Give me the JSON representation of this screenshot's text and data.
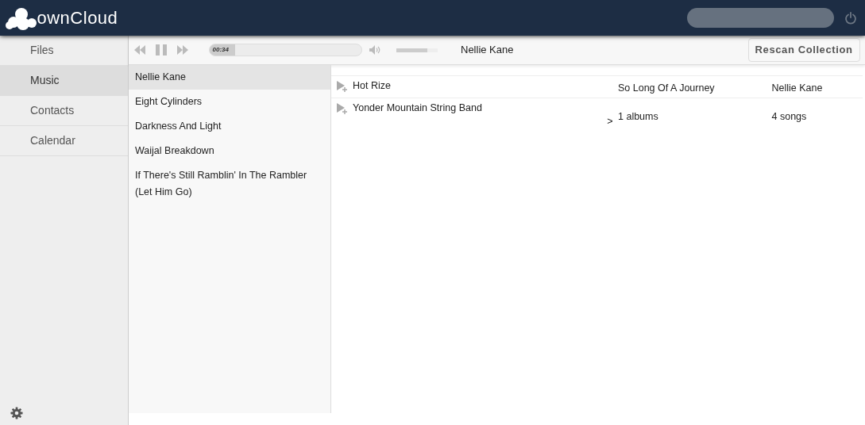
{
  "header": {
    "logo": "ownCloud"
  },
  "navigation": [
    {
      "label": "Files",
      "selected": false
    },
    {
      "label": "Music",
      "selected": true
    },
    {
      "label": "Contacts",
      "selected": false
    },
    {
      "label": "Calendar",
      "selected": false
    }
  ],
  "player": {
    "elapsed": "00:34",
    "level": 0.17,
    "volume": {
      "level": 0.75
    },
    "now_playing": "Nellie Kane",
    "playing": true
  },
  "rescan_button": "Rescan Collection",
  "artists": [
    {
      "name": "Nellie Kane",
      "selected": true
    },
    {
      "name": "Eight Cylinders",
      "selected": false
    },
    {
      "name": "Darkness And Light",
      "selected": false
    },
    {
      "name": "Waijal Breakdown",
      "selected": false
    },
    {
      "name": "If There's Still Ramblin' In The Rambler (Let Him Go)",
      "selected": false
    }
  ],
  "rows": [
    {
      "artist": "Hot Rize",
      "column_2": "So Long Of A Journey",
      "column_3": "Nellie Kane"
    },
    {
      "artist": "Yonder Mountain String Band",
      "column_2": "1 albums",
      "column_3": "4 songs",
      "expander": ">"
    }
  ]
}
